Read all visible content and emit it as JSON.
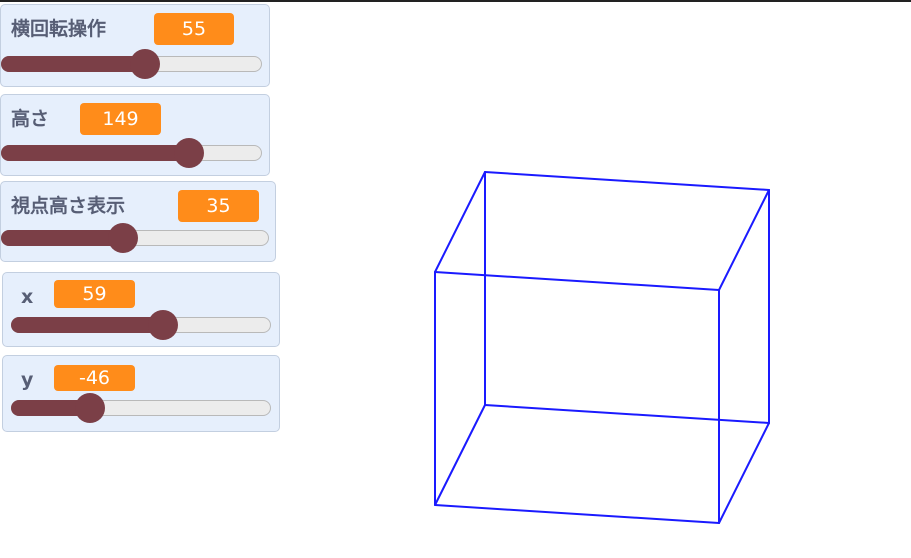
{
  "monitors": [
    {
      "label": "横回転操作",
      "value": "55",
      "level_fraction": 0.55
    },
    {
      "label": "高さ",
      "value": "149",
      "level_fraction": 0.72
    },
    {
      "label": "視点高さ表示",
      "value": "35",
      "level_fraction": 0.45
    },
    {
      "label": "x",
      "value": "59",
      "level_fraction": 0.58
    },
    {
      "label": "y",
      "value": "-46",
      "level_fraction": 0.3
    }
  ],
  "colors": {
    "monitor_bg": "#e6effc",
    "value_badge": "#ff8c1a",
    "slider_fill": "#7b3f47",
    "cube_edge": "#1a1aff"
  }
}
